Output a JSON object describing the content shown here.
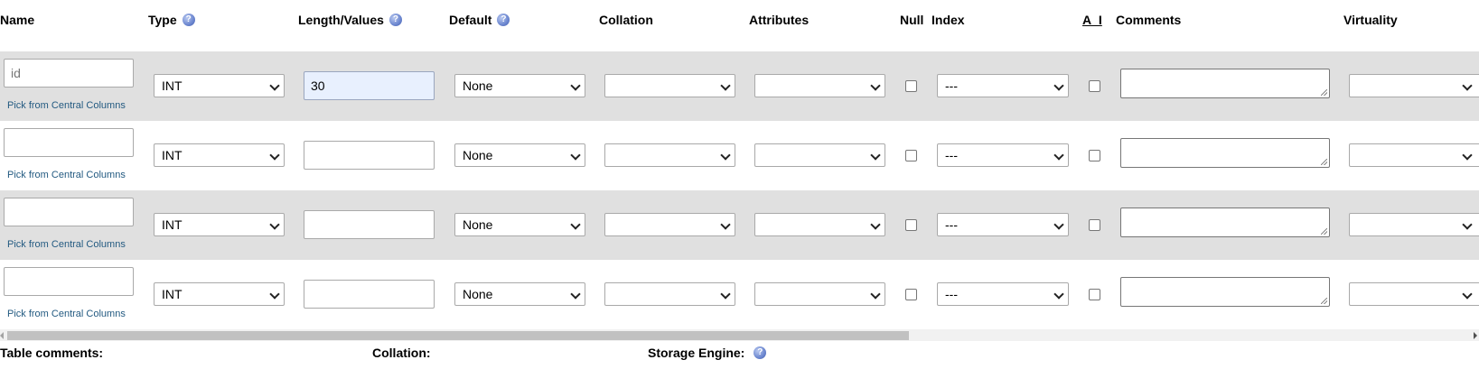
{
  "headers": {
    "name": "Name",
    "type": "Type",
    "length": "Length/Values",
    "default": "Default",
    "collation": "Collation",
    "attributes": "Attributes",
    "null": "Null",
    "index": "Index",
    "ai": "A_I",
    "comments": "Comments",
    "virtuality": "Virtuality",
    "help_icon": "help-icon"
  },
  "rows": [
    {
      "name_value": "",
      "name_placeholder": "id",
      "type": "INT",
      "length": "30",
      "default": "None",
      "collation": "",
      "attributes": "",
      "index": "---",
      "null_checked": false,
      "ai_checked": false,
      "comments": "",
      "virtuality": "",
      "pick_label": "Pick from Central Columns"
    },
    {
      "name_value": "",
      "name_placeholder": "",
      "type": "INT",
      "length": "",
      "default": "None",
      "collation": "",
      "attributes": "",
      "index": "---",
      "null_checked": false,
      "ai_checked": false,
      "comments": "",
      "virtuality": "",
      "pick_label": "Pick from Central Columns"
    },
    {
      "name_value": "",
      "name_placeholder": "",
      "type": "INT",
      "length": "",
      "default": "None",
      "collation": "",
      "attributes": "",
      "index": "---",
      "null_checked": false,
      "ai_checked": false,
      "comments": "",
      "virtuality": "",
      "pick_label": "Pick from Central Columns"
    },
    {
      "name_value": "",
      "name_placeholder": "",
      "type": "INT",
      "length": "",
      "default": "None",
      "collation": "",
      "attributes": "",
      "index": "---",
      "null_checked": false,
      "ai_checked": false,
      "comments": "",
      "virtuality": "",
      "pick_label": "Pick from Central Columns"
    }
  ],
  "footer": {
    "table_comments": "Table comments:",
    "collation": "Collation:",
    "storage_engine": "Storage Engine:"
  },
  "colors": {
    "row_shaded": "#e0e0e0",
    "link": "#235a81",
    "focused_input": "#e8f0fe"
  }
}
